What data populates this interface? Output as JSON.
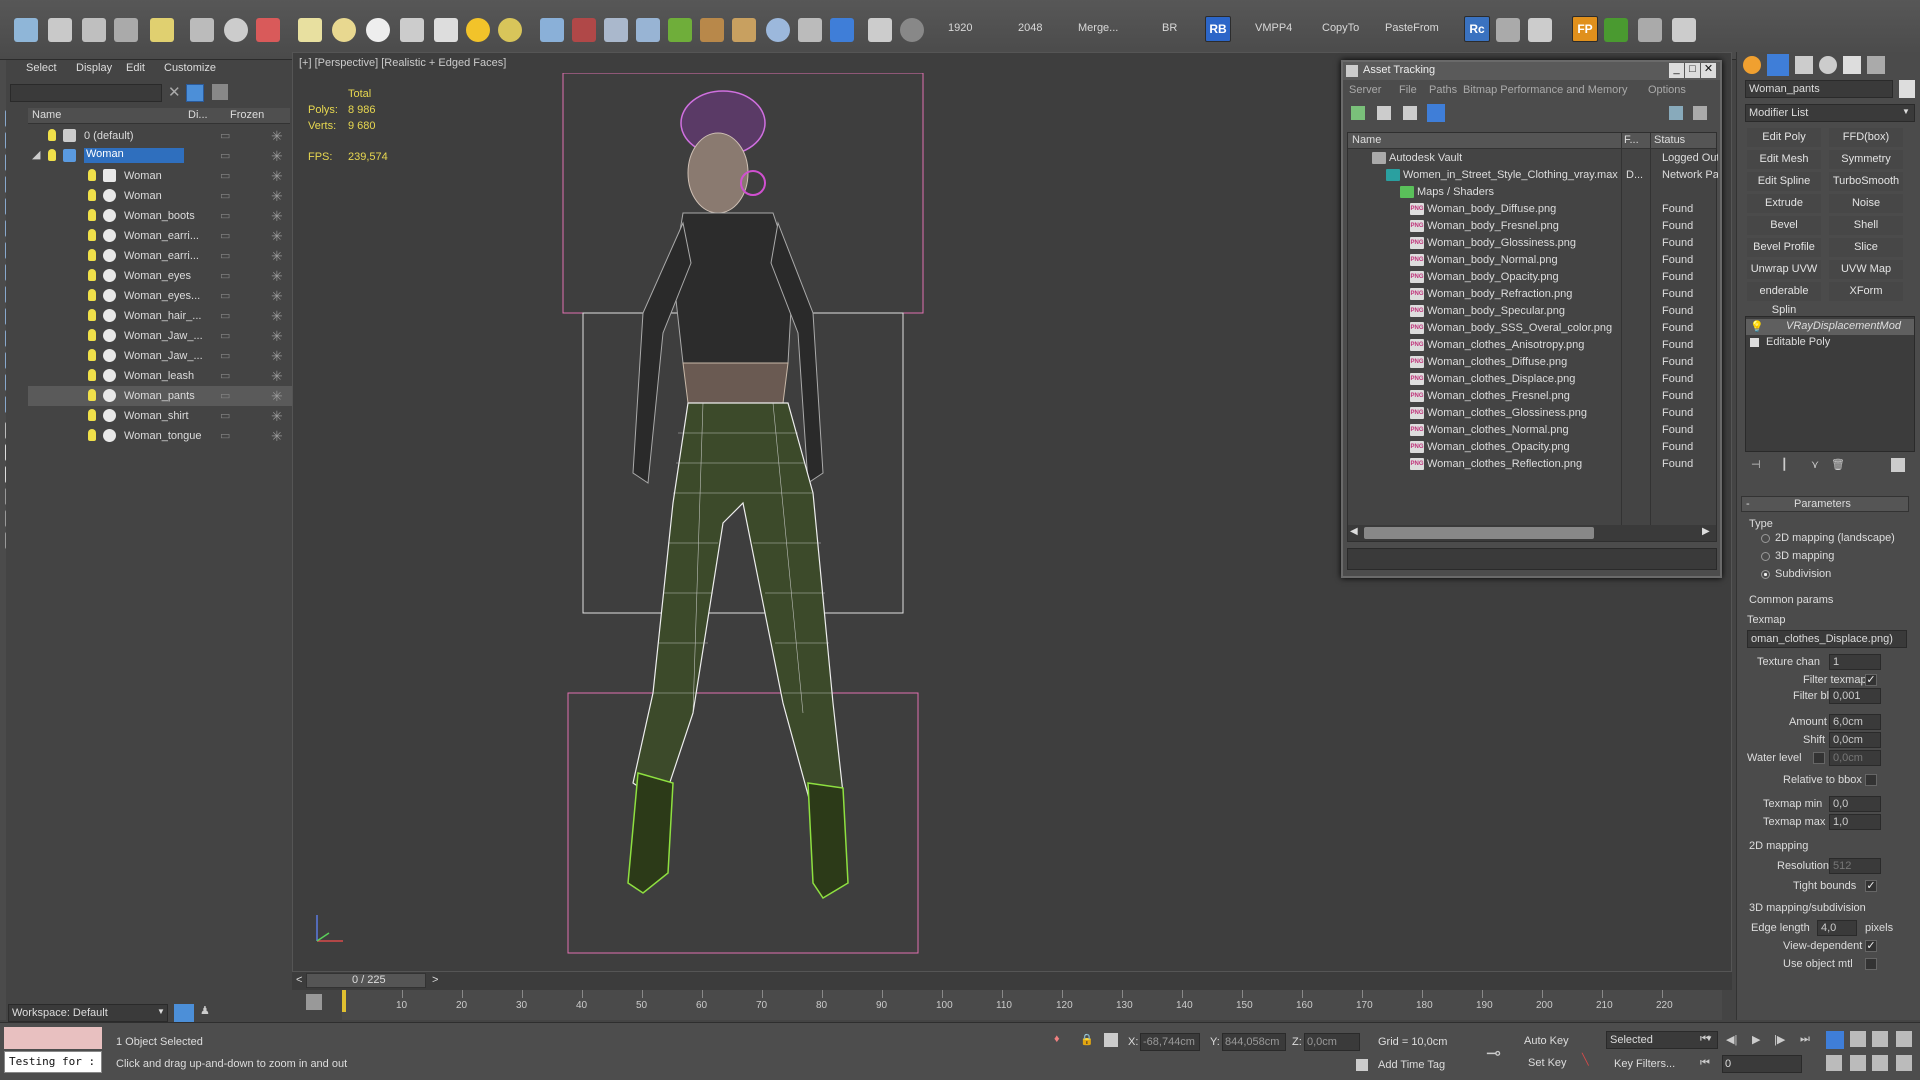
{
  "toolbar": {
    "items": [
      "1920",
      "2048",
      "Merge...",
      "BR",
      "RB",
      "VMPP4",
      "CopyTo",
      "PasteFrom",
      "Rc",
      "FP"
    ]
  },
  "explorer": {
    "menu": [
      "Select",
      "Display",
      "Edit",
      "Customize"
    ],
    "columns": {
      "name": "Name",
      "display": "Di...",
      "frozen": "Frozen"
    },
    "rows": [
      {
        "label": "0 (default)",
        "level": 0
      },
      {
        "label": "Woman",
        "level": 0
      },
      {
        "label": "Woman",
        "level": 1
      },
      {
        "label": "Woman",
        "level": 1
      },
      {
        "label": "Woman_boots",
        "level": 1
      },
      {
        "label": "Woman_earri...",
        "level": 1
      },
      {
        "label": "Woman_earri...",
        "level": 1
      },
      {
        "label": "Woman_eyes",
        "level": 1
      },
      {
        "label": "Woman_eyes...",
        "level": 1
      },
      {
        "label": "Woman_hair_...",
        "level": 1
      },
      {
        "label": "Woman_Jaw_...",
        "level": 1
      },
      {
        "label": "Woman_Jaw_...",
        "level": 1
      },
      {
        "label": "Woman_leash",
        "level": 1
      },
      {
        "label": "Woman_pants",
        "level": 1
      },
      {
        "label": "Woman_shirt",
        "level": 1
      },
      {
        "label": "Woman_tongue",
        "level": 1
      }
    ],
    "workspace": "Workspace: Default"
  },
  "viewport": {
    "label": "[+] [Perspective] [Realistic + Edged Faces]",
    "stats": {
      "total": "Total",
      "polys_label": "Polys:",
      "polys": "8 986",
      "verts_label": "Verts:",
      "verts": "9 680",
      "fps_label": "FPS:",
      "fps": "239,574"
    }
  },
  "asset_tracking": {
    "title": "Asset Tracking",
    "menu": [
      "Server",
      "File",
      "Paths",
      "Bitmap Performance and Memory",
      "Options"
    ],
    "columns": {
      "name": "Name",
      "f": "F...",
      "status": "Status"
    },
    "rows": [
      {
        "name": "Autodesk Vault",
        "status": "Logged Out",
        "kind": "vault"
      },
      {
        "name": "Women_in_Street_Style_Clothing_vray.max",
        "f": "D...",
        "status": "Network Path",
        "kind": "max"
      },
      {
        "name": "Maps / Shaders",
        "status": "",
        "kind": "folder"
      },
      {
        "name": "Woman_body_Diffuse.png",
        "status": "Found",
        "kind": "png"
      },
      {
        "name": "Woman_body_Fresnel.png",
        "status": "Found",
        "kind": "png"
      },
      {
        "name": "Woman_body_Glossiness.png",
        "status": "Found",
        "kind": "png"
      },
      {
        "name": "Woman_body_Normal.png",
        "status": "Found",
        "kind": "png"
      },
      {
        "name": "Woman_body_Opacity.png",
        "status": "Found",
        "kind": "png"
      },
      {
        "name": "Woman_body_Refraction.png",
        "status": "Found",
        "kind": "png"
      },
      {
        "name": "Woman_body_Specular.png",
        "status": "Found",
        "kind": "png"
      },
      {
        "name": "Woman_body_SSS_Overal_color.png",
        "status": "Found",
        "kind": "png"
      },
      {
        "name": "Woman_clothes_Anisotropy.png",
        "status": "Found",
        "kind": "png"
      },
      {
        "name": "Woman_clothes_Diffuse.png",
        "status": "Found",
        "kind": "png"
      },
      {
        "name": "Woman_clothes_Displace.png",
        "status": "Found",
        "kind": "png"
      },
      {
        "name": "Woman_clothes_Fresnel.png",
        "status": "Found",
        "kind": "png"
      },
      {
        "name": "Woman_clothes_Glossiness.png",
        "status": "Found",
        "kind": "png"
      },
      {
        "name": "Woman_clothes_Normal.png",
        "status": "Found",
        "kind": "png"
      },
      {
        "name": "Woman_clothes_Opacity.png",
        "status": "Found",
        "kind": "png"
      },
      {
        "name": "Woman_clothes_Reflection.png",
        "status": "Found",
        "kind": "png"
      }
    ]
  },
  "command_panel": {
    "object_name": "Woman_pants",
    "modifier_list": "Modifier List",
    "modifier_buttons": [
      "Edit Poly",
      "FFD(box)",
      "Edit Mesh",
      "Symmetry",
      "Edit Spline",
      "TurboSmooth",
      "Extrude",
      "Noise",
      "Bevel",
      "Shell",
      "Bevel Profile",
      "Slice",
      "Unwrap UVW",
      "UVW Map",
      "enderable Splin",
      "XForm"
    ],
    "stack": [
      "VRayDisplacementMod",
      "Editable Poly"
    ],
    "parameters_title": "Parameters",
    "type_label": "Type",
    "type_options": [
      "2D mapping (landscape)",
      "3D mapping",
      "Subdivision"
    ],
    "common_params": "Common params",
    "texmap_label": "Texmap",
    "texmap_value": "oman_clothes_Displace.png)",
    "texture_chan_label": "Texture chan",
    "texture_chan": "1",
    "filter_texmap_label": "Filter texmap",
    "filter_blur_label": "Filter blur",
    "filter_blur": "0,001",
    "amount_label": "Amount",
    "amount": "6,0cm",
    "shift_label": "Shift",
    "shift": "0,0cm",
    "water_level_label": "Water level",
    "water_level": "0,0cm",
    "relative_bbox_label": "Relative to bbox",
    "texmap_min_label": "Texmap min",
    "texmap_min": "0,0",
    "texmap_max_label": "Texmap max",
    "texmap_max": "1,0",
    "mapping2d_title": "2D mapping",
    "resolution_label": "Resolution",
    "resolution": "512",
    "tight_bounds_label": "Tight bounds",
    "mapping3d_title": "3D mapping/subdivision",
    "edge_length_label": "Edge length",
    "edge_length": "4,0",
    "pixels_label": "pixels",
    "view_dependent_label": "View-dependent",
    "use_object_mtl_label": "Use object mtl"
  },
  "timeline": {
    "frame_counter": "0 / 225",
    "ticks": [
      "10",
      "20",
      "30",
      "40",
      "50",
      "60",
      "70",
      "80",
      "90",
      "100",
      "110",
      "120",
      "130",
      "140",
      "150",
      "160",
      "170",
      "180",
      "190",
      "200",
      "210",
      "220"
    ]
  },
  "status": {
    "maxscript": "Testing for :",
    "selection": "1 Object Selected",
    "prompt": "Click and drag up-and-down to zoom in and out",
    "x_label": "X:",
    "x": "-68,744cm",
    "y_label": "Y:",
    "y": "844,058cm",
    "z_label": "Z:",
    "z": "0,0cm",
    "grid": "Grid = 10,0cm",
    "add_time_tag": "Add Time Tag",
    "auto_key": "Auto Key",
    "set_key": "Set Key",
    "selected": "Selected",
    "key_filters": "Key Filters...",
    "frame": "0"
  }
}
